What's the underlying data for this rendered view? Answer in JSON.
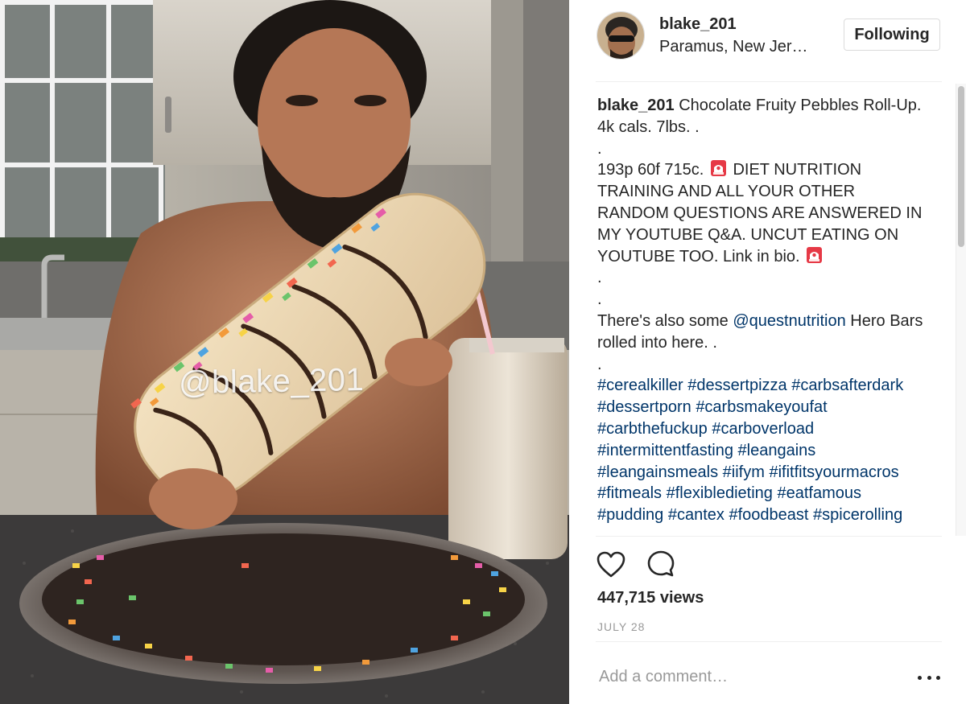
{
  "post": {
    "username": "blake_201",
    "location": "Paramus, New Jer…",
    "follow_label": "Following",
    "media": {
      "watermark": "@blake_201"
    }
  },
  "caption": {
    "username": "blake_201",
    "line1": "Chocolate Fruity Pebbles Roll-Up. 4k cals. 7lbs. .",
    "dot1": ".",
    "macros": "193p 60f 715c.",
    "shout": "DIET NUTRITION TRAINING AND ALL YOUR OTHER RANDOM QUESTIONS ARE ANSWERED IN MY YOUTUBE Q&A. UNCUT EATING ON YOUTUBE TOO. Link in bio.",
    "dot2": ".",
    "dot3": ".",
    "quest_pre": "There's also some",
    "quest_mention": "@questnutrition",
    "quest_post": "Hero Bars rolled into here. .",
    "dot4": ".",
    "hashtags": [
      "#cerealkiller",
      "#dessertpizza",
      "#carbsafterdark",
      "#dessertporn",
      "#carbsmakeyoufat",
      "#carbthefuckup",
      "#carboverload",
      "#intermittentfasting",
      "#leangains",
      "#leangainsmeals",
      "#iifym",
      "#ifitfitsyourmacros",
      "#fitmeals",
      "#flexibledieting",
      "#eatfamous",
      "#pudding",
      "#cantex",
      "#foodbeast",
      "#spicerolling"
    ]
  },
  "stats": {
    "views": "447,715 views",
    "date": "JULY 28"
  },
  "comment": {
    "placeholder": "Add a comment…"
  },
  "icons": {
    "like": "heart-icon",
    "comment": "speech-bubble-icon",
    "more": "more-options-icon",
    "siren": "rotating-light-icon"
  },
  "colors": {
    "link": "#003569",
    "muted": "#999999",
    "text": "#262626",
    "border": "#dbdbdb"
  }
}
